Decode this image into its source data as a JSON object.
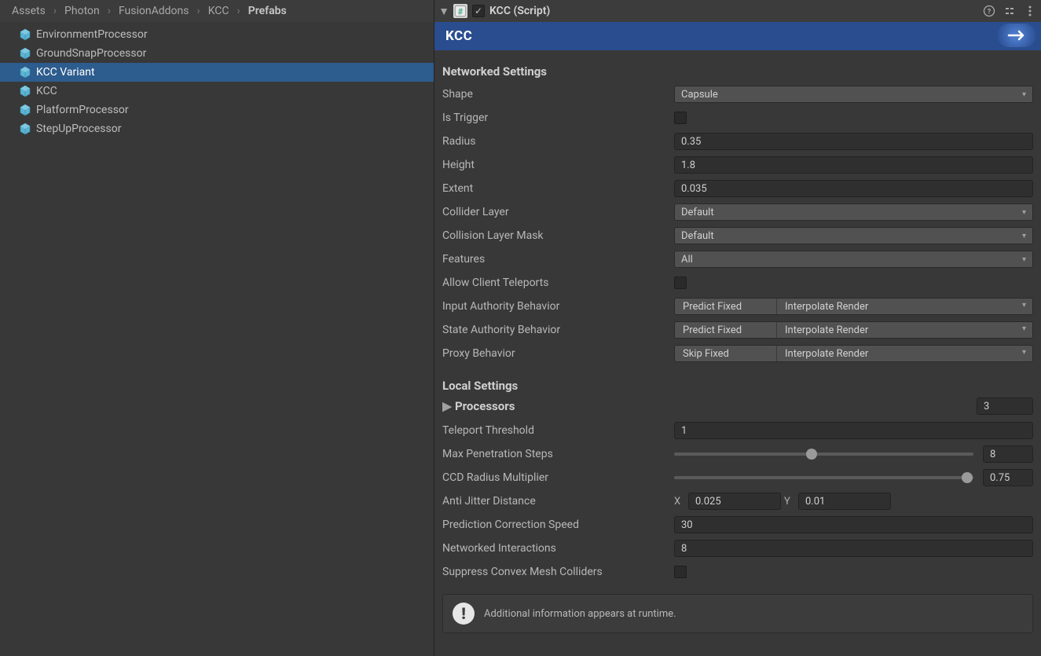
{
  "breadcrumb": [
    "Assets",
    "Photon",
    "FusionAddons",
    "KCC",
    "Prefabs"
  ],
  "assets": [
    {
      "name": "EnvironmentProcessor",
      "selected": false
    },
    {
      "name": "GroundSnapProcessor",
      "selected": false
    },
    {
      "name": "KCC Variant",
      "selected": true
    },
    {
      "name": "KCC",
      "selected": false
    },
    {
      "name": "PlatformProcessor",
      "selected": false
    },
    {
      "name": "StepUpProcessor",
      "selected": false
    }
  ],
  "component": {
    "title": "KCC (Script)",
    "enabled": true,
    "banner": "KCC"
  },
  "networked": {
    "heading": "Networked Settings",
    "shape_label": "Shape",
    "shape_value": "Capsule",
    "is_trigger_label": "Is Trigger",
    "is_trigger_value": false,
    "radius_label": "Radius",
    "radius_value": "0.35",
    "height_label": "Height",
    "height_value": "1.8",
    "extent_label": "Extent",
    "extent_value": "0.035",
    "collider_layer_label": "Collider Layer",
    "collider_layer_value": "Default",
    "collision_mask_label": "Collision Layer Mask",
    "collision_mask_value": "Default",
    "features_label": "Features",
    "features_value": "All",
    "allow_teleports_label": "Allow Client Teleports",
    "allow_teleports_value": false,
    "input_auth_label": "Input Authority Behavior",
    "input_auth_v1": "Predict Fixed",
    "input_auth_v2": "Interpolate Render",
    "state_auth_label": "State Authority Behavior",
    "state_auth_v1": "Predict Fixed",
    "state_auth_v2": "Interpolate Render",
    "proxy_label": "Proxy Behavior",
    "proxy_v1": "Skip Fixed",
    "proxy_v2": "Interpolate Render"
  },
  "local": {
    "heading": "Local Settings",
    "processors_label": "Processors",
    "processors_count": "3",
    "teleport_label": "Teleport Threshold",
    "teleport_value": "1",
    "maxpen_label": "Max Penetration Steps",
    "maxpen_value": "8",
    "maxpen_slider_pct": 46,
    "ccd_label": "CCD Radius Multiplier",
    "ccd_value": "0.75",
    "ccd_slider_pct": 98,
    "antijitter_label": "Anti Jitter Distance",
    "antijitter_x": "0.025",
    "antijitter_y": "0.01",
    "predcorr_label": "Prediction Correction Speed",
    "predcorr_value": "30",
    "netinter_label": "Networked Interactions",
    "netinter_value": "8",
    "suppress_label": "Suppress Convex Mesh Colliders",
    "suppress_value": false
  },
  "info_message": "Additional information appears at runtime."
}
